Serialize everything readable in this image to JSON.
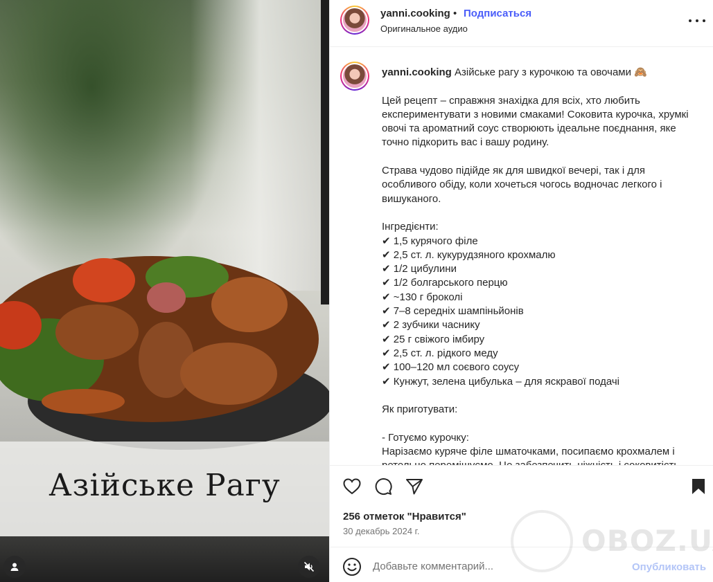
{
  "media": {
    "overlay_title": "Азійське Рагу",
    "user_button_icon": "user-icon",
    "mute_button_icon": "muted-speaker-icon"
  },
  "header": {
    "username": "yanni.cooking",
    "separator": "•",
    "follow_label": "Подписаться",
    "audio_label": "Оригинальное аудио",
    "more_icon": "more-horizontal-icon"
  },
  "caption": {
    "username": "yanni.cooking",
    "text": " Азійське рагу з курочкою та овочами 🙈\n\nЦей рецепт – справжня знахідка для всіх, хто любить експериментувати з новими смаками! Соковита курочка, хрумкі овочі та ароматний соус створюють ідеальне поєднання, яке точно підкорить вас і вашу родину.\n\nСтрава чудово підійде як для швидкої вечері, так і для особливого обіду, коли хочеться чогось водночас легкого і вишуканого.\n\nІнгредієнти:\n✔ 1,5 курячого філе\n✔ 2,5 ст. л. кукурудзяного крохмалю\n✔ 1/2 цибулини\n✔ 1/2 болгарського перцю\n✔ ~130 г броколі\n✔ 7–8 середніх шампіньйонів\n✔ 2 зубчики часнику\n✔ 25 г свіжого імбиру\n✔ 2,5 ст. л. рідкого меду\n✔ 100–120 мл соєвого соусу\n✔ Кунжут, зелена цибулька – для яскравої подачі\n\nЯк приготувати:\n\n- Готуємо курочку:\nНарізаємо куряче філе шматочками, посипаємо крохмалем і ретельно перемішуємо. Це забезпечить ніжність і соковитість."
  },
  "actions": {
    "like_icon": "heart-icon",
    "comment_icon": "comment-icon",
    "share_icon": "send-icon",
    "save_icon": "bookmark-icon",
    "likes_text": "256 отметок \"Нравится\"",
    "date_text": "30 декабрь 2024 г."
  },
  "comment": {
    "emoji_icon": "emoji-icon",
    "placeholder": "Добавьте комментарий...",
    "publish_label": "Опубликовать"
  },
  "watermark": {
    "text": "OBOZ.UA"
  },
  "colors": {
    "follow": "#4a5df9",
    "publish_disabled": "#b3c5f7",
    "text": "#262626",
    "secondary": "#737373"
  }
}
